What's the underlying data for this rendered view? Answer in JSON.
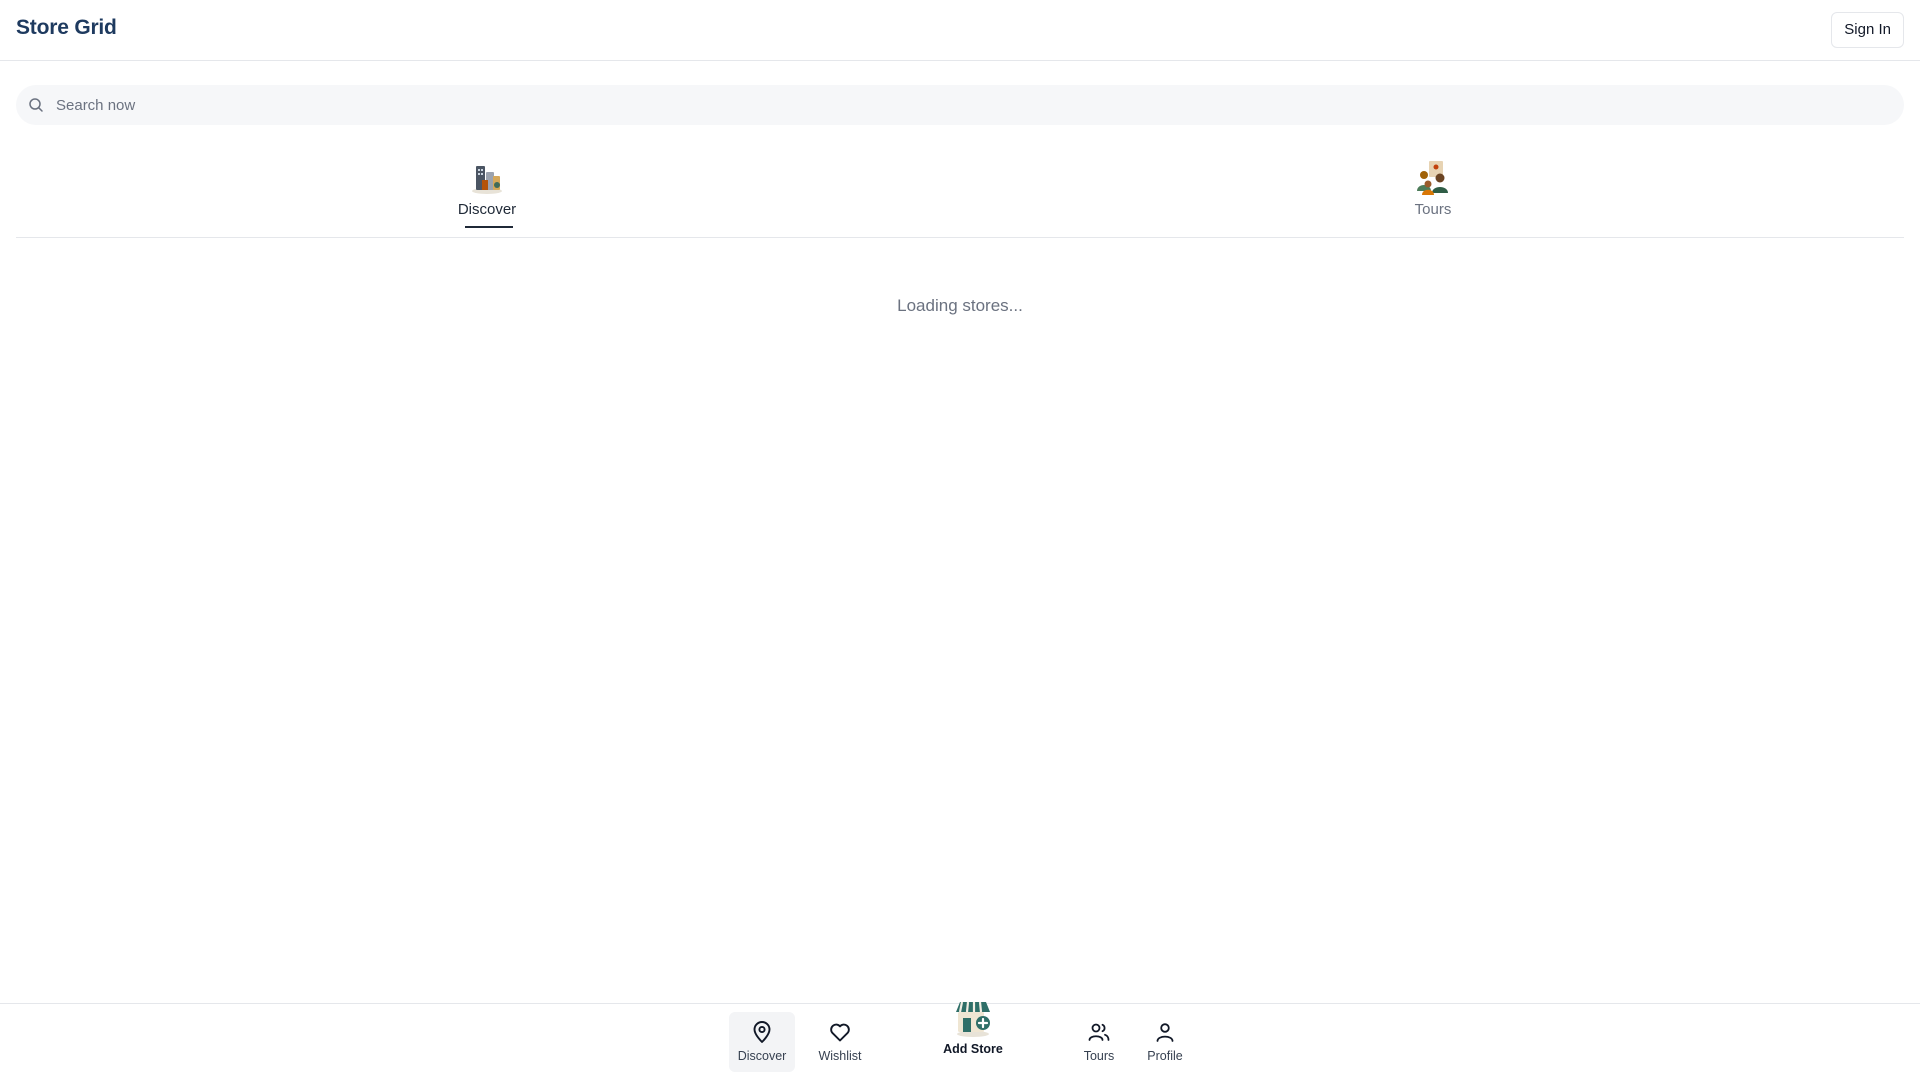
{
  "app": {
    "title": "Store Grid"
  },
  "header": {
    "sign_in_label": "Sign In"
  },
  "search": {
    "placeholder": "Search now",
    "value": "",
    "icon": "search-icon"
  },
  "tabs": [
    {
      "label": "Discover",
      "icon": "city-buildings-icon",
      "active": true
    },
    {
      "label": "Tours",
      "icon": "tour-people-icon",
      "active": false
    }
  ],
  "main": {
    "status_text": "Loading stores..."
  },
  "bottom_nav": {
    "items": [
      {
        "label": "Discover",
        "icon": "map-pin-icon",
        "active": true
      },
      {
        "label": "Wishlist",
        "icon": "heart-icon",
        "active": false
      },
      {
        "label": "Add Store",
        "icon": "storefront-plus-icon",
        "active": false
      },
      {
        "label": "Tours",
        "icon": "users-icon",
        "active": false
      },
      {
        "label": "Profile",
        "icon": "user-icon",
        "active": false
      }
    ]
  },
  "colors": {
    "brand": "#1e3a5f",
    "muted_text": "#6b7280",
    "border": "#e5e7eb",
    "search_bg": "#f6f7f9"
  }
}
